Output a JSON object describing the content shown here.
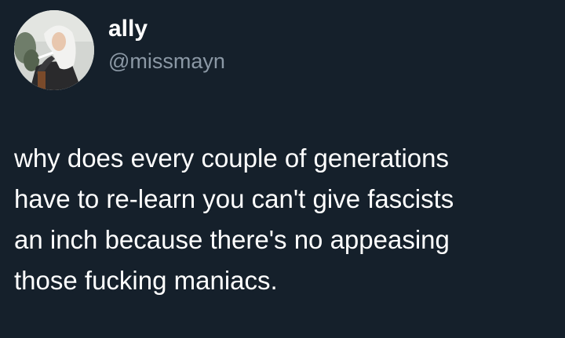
{
  "tweet": {
    "author": {
      "display_name": "ally",
      "handle": "@missmayn",
      "avatar_icon": "profile-avatar"
    },
    "lines": [
      "why does every couple of generations",
      "have to re-learn  you can't give fascists",
      "an inch because there's no appeasing",
      "those fucking maniacs."
    ]
  },
  "colors": {
    "background": "#15202b",
    "text_primary": "#ffffff",
    "text_secondary": "#8b98a5"
  }
}
